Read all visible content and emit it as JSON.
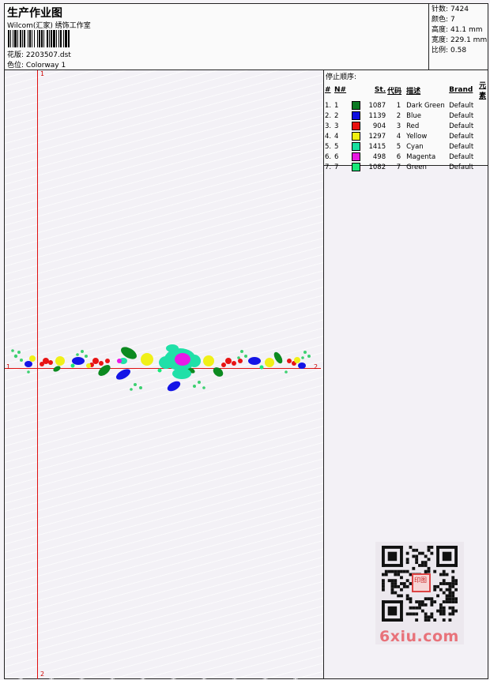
{
  "header": {
    "title": "生产作业图",
    "studio": "Wilcom(汇家) 绣饰工作室",
    "design_label": "花版:",
    "design_value": "2203507.dst",
    "colorway_label": "色位:",
    "colorway_value": "Colorway 1"
  },
  "stats": {
    "stitches_label": "针数:",
    "stitches_value": "7424",
    "colors_label": "颜色:",
    "colors_value": "7",
    "height_label": "高度:",
    "height_value": "41.1 mm",
    "width_label": "宽度:",
    "width_value": "229.1 mm",
    "scale_label": "比例:",
    "scale_value": "0.58"
  },
  "markers": {
    "top": "1",
    "bottom": "2",
    "left": "1",
    "right": "2"
  },
  "sequence": {
    "title": "停止顺序:",
    "columns": [
      "#",
      "N#",
      "St.",
      "代码",
      "描述",
      "Brand",
      "元素"
    ],
    "rows": [
      {
        "idx": "1.",
        "n": "1",
        "color": "#0c7a23",
        "st": "1087",
        "code": "1",
        "desc": "Dark Green",
        "brand": "Default"
      },
      {
        "idx": "2.",
        "n": "2",
        "color": "#1010e0",
        "st": "1139",
        "code": "2",
        "desc": "Blue",
        "brand": "Default"
      },
      {
        "idx": "3.",
        "n": "3",
        "color": "#e81010",
        "st": "904",
        "code": "3",
        "desc": "Red",
        "brand": "Default"
      },
      {
        "idx": "4.",
        "n": "4",
        "color": "#f0f010",
        "st": "1297",
        "code": "4",
        "desc": "Yellow",
        "brand": "Default"
      },
      {
        "idx": "5.",
        "n": "5",
        "color": "#18e0a0",
        "st": "1415",
        "code": "5",
        "desc": "Cyan",
        "brand": "Default"
      },
      {
        "idx": "6.",
        "n": "6",
        "color": "#e818e0",
        "st": "498",
        "code": "6",
        "desc": "Magenta",
        "brand": "Default"
      },
      {
        "idx": "7.",
        "n": "7",
        "color": "#18e878",
        "st": "1082",
        "code": "7",
        "desc": "Green",
        "brand": "Default"
      }
    ]
  },
  "watermark": {
    "site": "6xiu.com",
    "seal": "印图"
  }
}
